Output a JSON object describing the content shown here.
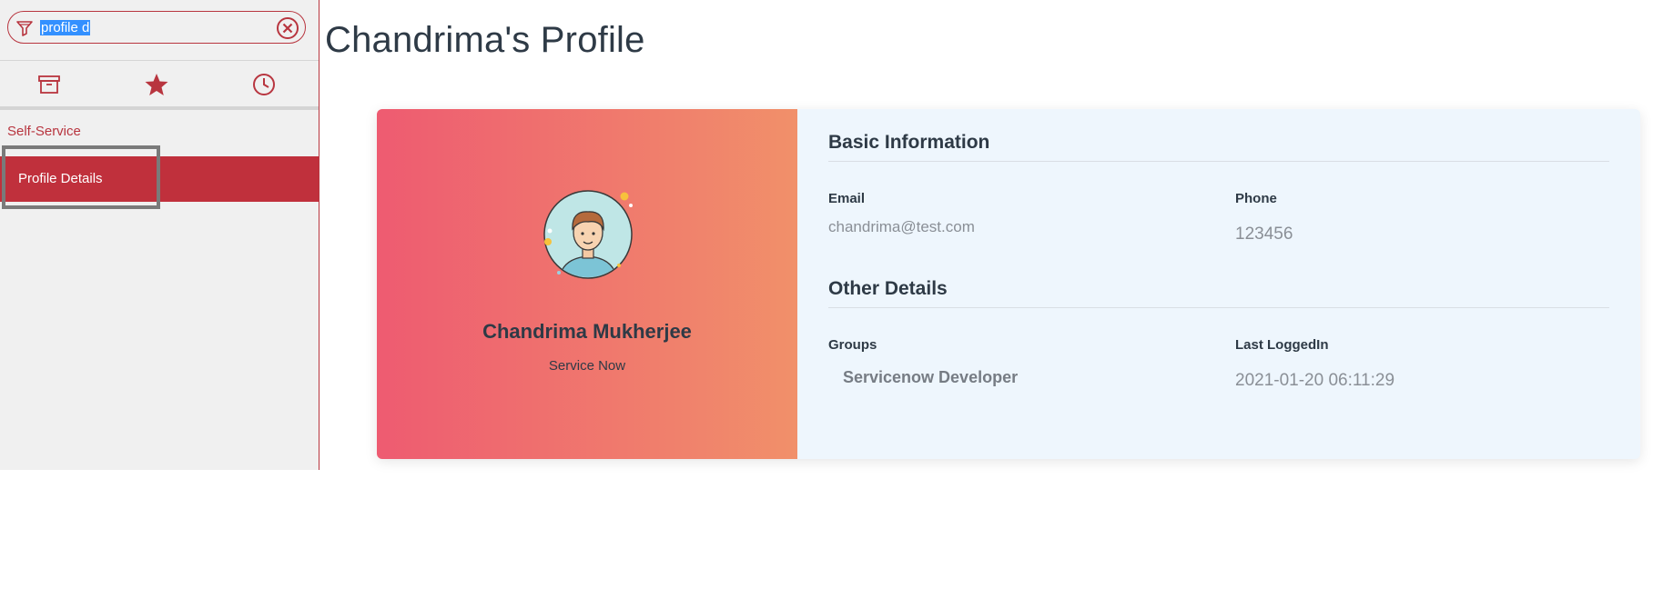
{
  "filter": {
    "value": "profile d",
    "icon": "funnel-icon",
    "clear_icon": "close-circle-icon"
  },
  "nav_tabs": [
    {
      "name": "all-applications",
      "icon": "archive-box-icon"
    },
    {
      "name": "favorites",
      "icon": "star-icon"
    },
    {
      "name": "history",
      "icon": "clock-icon"
    }
  ],
  "sidebar": {
    "app_label": "Self-Service",
    "module_label": "Profile Details"
  },
  "page": {
    "title": "Chandrima's Profile"
  },
  "profile": {
    "name": "Chandrima Mukherjee",
    "company": "Service Now"
  },
  "basic_info": {
    "title": "Basic Information",
    "email_label": "Email",
    "email_value": "chandrima@test.com",
    "phone_label": "Phone",
    "phone_value": "123456"
  },
  "other_details": {
    "title": "Other Details",
    "groups_label": "Groups",
    "groups_value": "Servicenow Developer",
    "last_logged_label": "Last LoggedIn",
    "last_logged_value": "2021-01-20 06:11:29"
  },
  "colors": {
    "accent": "#b8353f",
    "module_bg": "#c0303c",
    "gradient_start": "#ee5b71",
    "gradient_end": "#f1906a",
    "card_bg": "#eef6fd"
  }
}
